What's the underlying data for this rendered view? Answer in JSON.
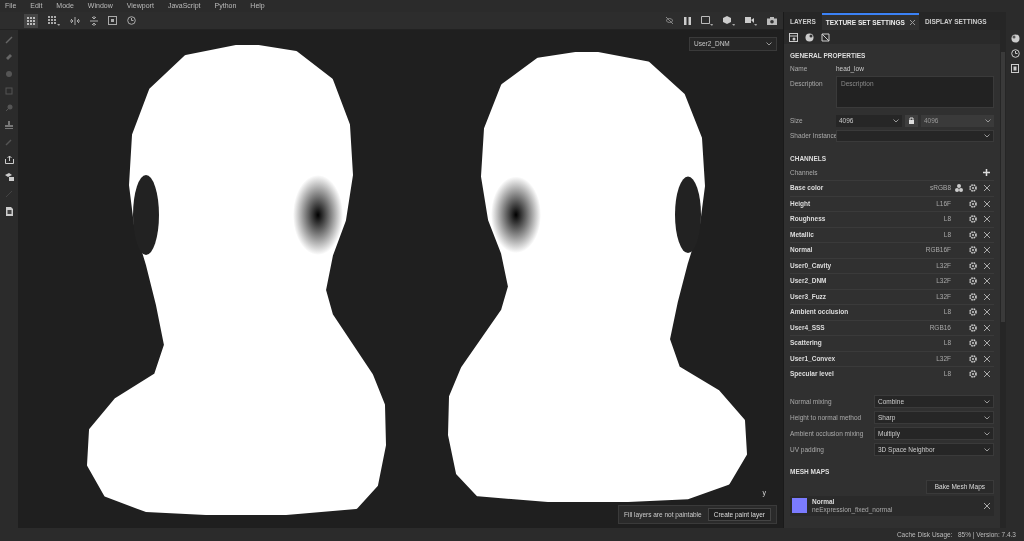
{
  "menu": [
    "File",
    "Edit",
    "Mode",
    "Window",
    "Viewport",
    "JavaScript",
    "Python",
    "Help"
  ],
  "viewport": {
    "channel_select": "User2_DNM",
    "axis_label": "y",
    "notice": {
      "text": "Fill layers are not paintable",
      "button": "Create paint layer"
    }
  },
  "panel": {
    "tabs": [
      {
        "label": "LAYERS",
        "selected": false,
        "closable": false
      },
      {
        "label": "TEXTURE SET SETTINGS",
        "selected": true,
        "closable": true
      },
      {
        "label": "DISPLAY SETTINGS",
        "selected": false,
        "closable": false
      }
    ],
    "general": {
      "heading": "GENERAL PROPERTIES",
      "name_label": "Name",
      "name_value": "head_low",
      "description_label": "Description",
      "description_placeholder": "Description",
      "size_label": "Size",
      "size_value": "4096",
      "size_linked_value": "4096",
      "shader_label": "Shader Instance"
    },
    "channels": {
      "heading": "CHANNELS",
      "label": "Channels",
      "rows": [
        {
          "name": "Base color",
          "format": "sRGB8",
          "kind": "color"
        },
        {
          "name": "Height",
          "format": "L16F",
          "kind": "plain"
        },
        {
          "name": "Roughness",
          "format": "L8",
          "kind": "plain"
        },
        {
          "name": "Metallic",
          "format": "L8",
          "kind": "plain"
        },
        {
          "name": "Normal",
          "format": "RGB16F",
          "kind": "plain"
        },
        {
          "name": "User0_Cavity",
          "format": "L32F",
          "kind": "plain"
        },
        {
          "name": "User2_DNM",
          "format": "L32F",
          "kind": "plain"
        },
        {
          "name": "User3_Fuzz",
          "format": "L32F",
          "kind": "plain"
        },
        {
          "name": "Ambient occlusion",
          "format": "L8",
          "kind": "plain"
        },
        {
          "name": "User4_SSS",
          "format": "RGB16",
          "kind": "plain"
        },
        {
          "name": "Scattering",
          "format": "L8",
          "kind": "plain"
        },
        {
          "name": "User1_Convex",
          "format": "L32F",
          "kind": "plain"
        },
        {
          "name": "Specular level",
          "format": "L8",
          "kind": "plain"
        }
      ]
    },
    "settings": [
      {
        "label": "Normal mixing",
        "value": "Combine"
      },
      {
        "label": "Height to normal method",
        "value": "Sharp"
      },
      {
        "label": "Ambient occlusion mixing",
        "value": "Multiply"
      },
      {
        "label": "UV padding",
        "value": "3D Space Neighbor"
      }
    ],
    "mesh_maps": {
      "heading": "MESH MAPS",
      "bake_button": "Bake Mesh Maps",
      "items": [
        {
          "name": "Normal",
          "file": "neExpression_fixed_normal",
          "color": "#7b7bff"
        }
      ]
    }
  },
  "status_bar": "Cache Disk Usage:   85% | Version: 7.4.3"
}
